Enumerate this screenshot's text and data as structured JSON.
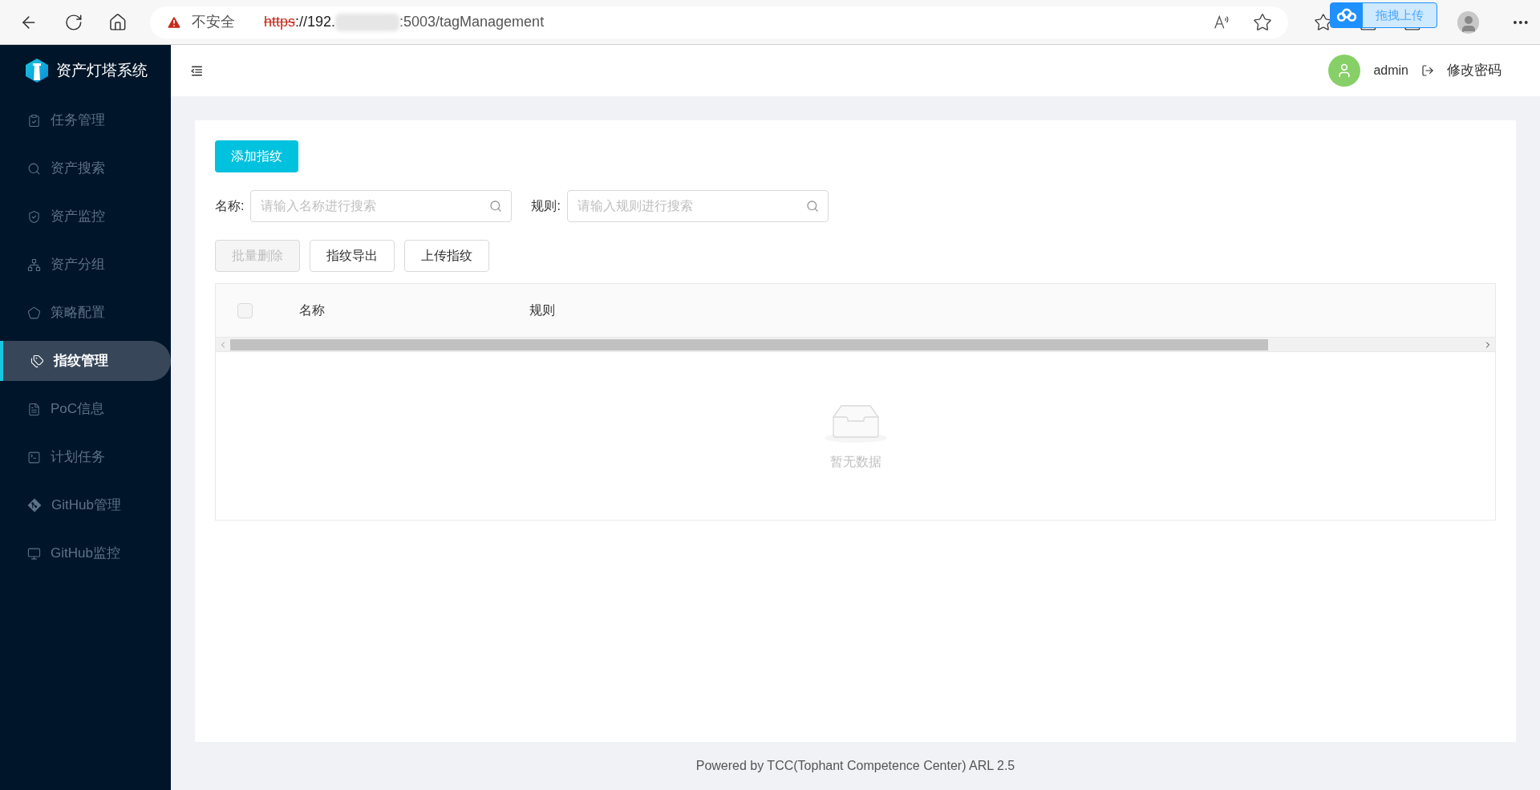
{
  "browser": {
    "security_label": "不安全",
    "url_scheme": "https",
    "url_host": "://192.",
    "url_port_path": ":5003/tagManagement",
    "extension_label": "拖拽上传"
  },
  "sidebar": {
    "brand": "资产灯塔系统",
    "items": [
      {
        "label": "任务管理",
        "selected": false
      },
      {
        "label": "资产搜索",
        "selected": false
      },
      {
        "label": "资产监控",
        "selected": false
      },
      {
        "label": "资产分组",
        "selected": false
      },
      {
        "label": "策略配置",
        "selected": false
      },
      {
        "label": "指纹管理",
        "selected": true
      },
      {
        "label": "PoC信息",
        "selected": false
      },
      {
        "label": "计划任务",
        "selected": false
      },
      {
        "label": "GitHub管理",
        "selected": false
      },
      {
        "label": "GitHub监控",
        "selected": false
      }
    ]
  },
  "header": {
    "username": "admin",
    "change_password": "修改密码"
  },
  "add_button": "添加指纹",
  "filters": [
    {
      "label": "名称:",
      "placeholder": "请输入名称进行搜索"
    },
    {
      "label": "规则:",
      "placeholder": "请输入规则进行搜索"
    }
  ],
  "actions": [
    {
      "label": "批量删除",
      "disabled": true
    },
    {
      "label": "指纹导出",
      "disabled": false
    },
    {
      "label": "上传指纹",
      "disabled": false
    }
  ],
  "table": {
    "select_all_checked": false,
    "columns": [
      "名称",
      "规则"
    ],
    "empty_text": "暂无数据"
  },
  "footer": "Powered by TCC(Tophant Competence Center) ARL 2.5"
}
